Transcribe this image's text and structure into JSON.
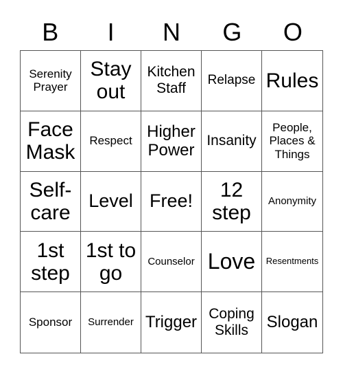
{
  "header": [
    "B",
    "I",
    "N",
    "G",
    "O"
  ],
  "cells": [
    "Serenity Prayer",
    "Stay out",
    "Kitchen Staff",
    "Relapse",
    "Rules",
    "Face Mask",
    "Respect",
    "Higher Power",
    "Insanity",
    "People, Places & Things",
    "Self-care",
    "Level",
    "Free!",
    "12 step",
    "Anonymity",
    "1st step",
    "1st to go",
    "Counselor",
    "Love",
    "Resentments",
    "Sponsor",
    "Surrender",
    "Trigger",
    "Coping Skills",
    "Slogan"
  ]
}
